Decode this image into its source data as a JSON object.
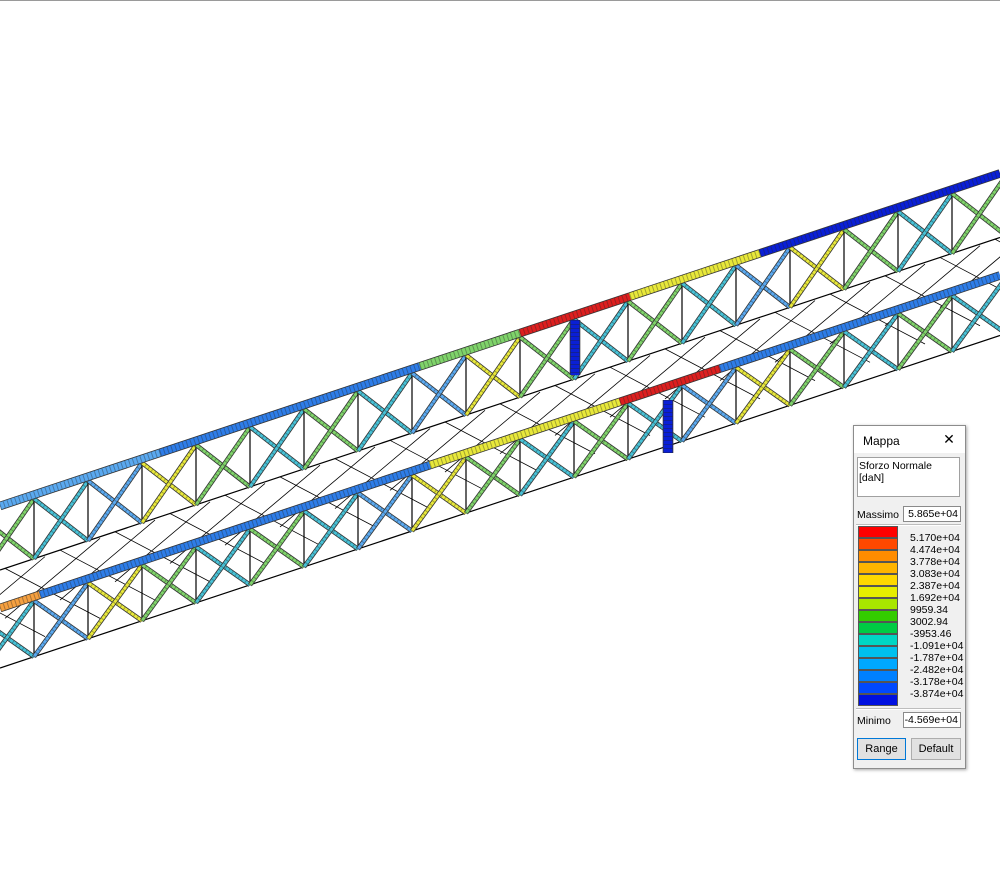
{
  "mappa": {
    "title": "Mappa",
    "close_icon": "close-icon",
    "quantity": "Sforzo Normale [daN]",
    "max_label": "Massimo",
    "max_value": "5.865e+04",
    "min_label": "Minimo",
    "min_value": "-4.569e+04",
    "range_button": "Range",
    "default_button": "Default",
    "colors": [
      "#ff0000",
      "#ff4800",
      "#ff8c00",
      "#ffb400",
      "#ffd800",
      "#e6ee00",
      "#a8e600",
      "#33cc00",
      "#00cc44",
      "#00d6c4",
      "#00c0ee",
      "#00a8ff",
      "#0080ff",
      "#0048ff",
      "#0010e0"
    ],
    "levels": [
      "5.170e+04",
      "4.474e+04",
      "3.778e+04",
      "3.083e+04",
      "2.387e+04",
      "1.692e+04",
      "9959.34",
      "3002.94",
      "-3953.46",
      "-1.091e+04",
      "-1.787e+04",
      "-2.482e+04",
      "-3.178e+04",
      "-3.874e+04"
    ]
  },
  "model": {
    "colors": {
      "compression_high": "#0a1fd6",
      "compression_mid": "#2e7de8",
      "compression_low": "#5aa9f0",
      "neutral": "#47c1d6",
      "low_tension": "#7fd36a",
      "tension_mid": "#e8e83a",
      "tension_high": "#f5a040",
      "tension_max": "#dd1f1f",
      "frame": "#000000"
    }
  }
}
